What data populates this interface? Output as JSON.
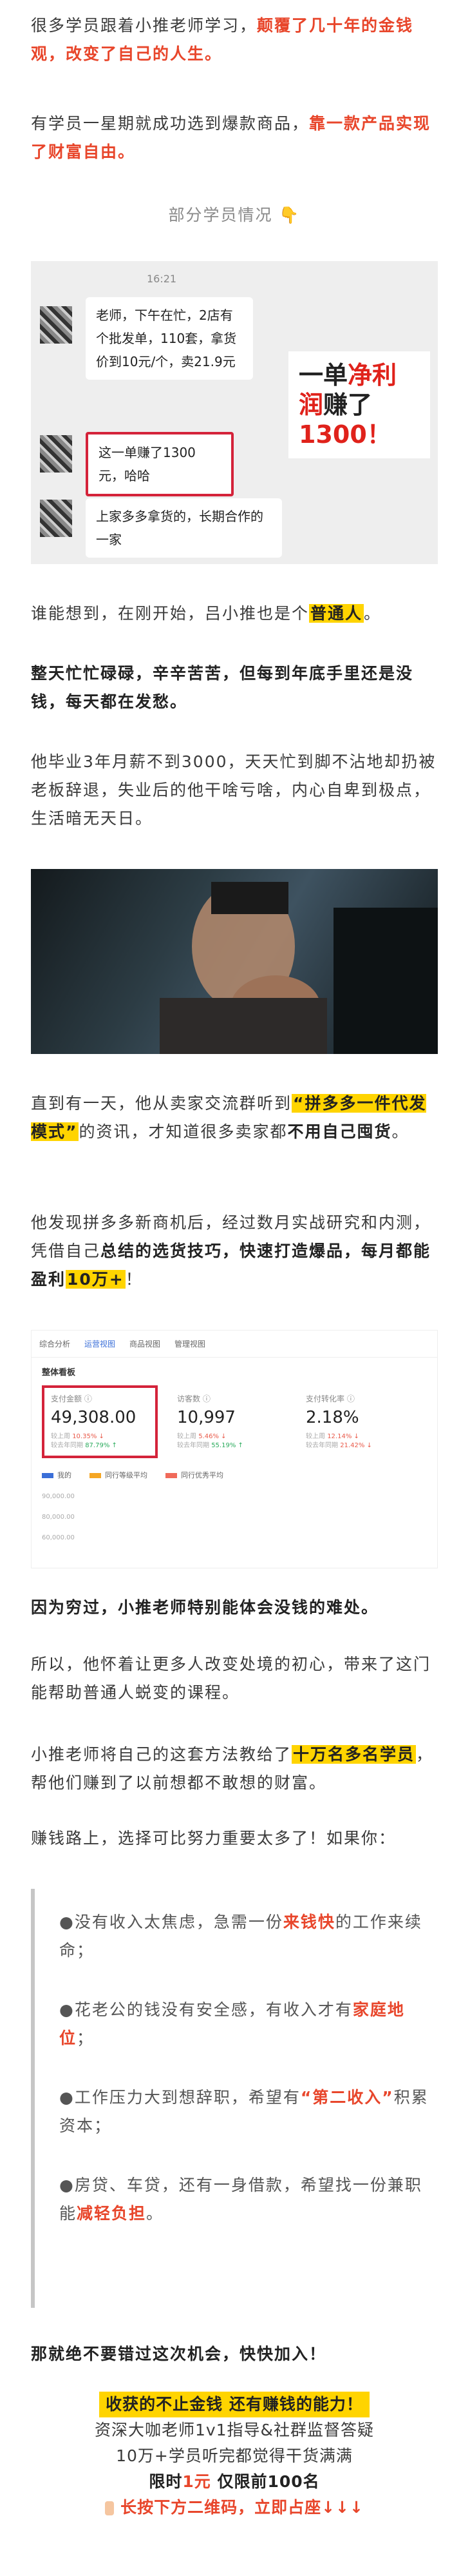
{
  "para1": {
    "a": "很多学员跟着小推老师学习，",
    "b": "颠覆了几十年的金钱观，改变了自己的人生。"
  },
  "para2": {
    "a": "有学员一星期就成功选到爆款商品，",
    "b": "靠一款产品实现了财富自由。"
  },
  "students_caption": "部分学员情况 👇",
  "chat": {
    "time": "16:21",
    "msg1": "老师，下午在忙，2店有个批发单，110套，拿货价到10元/个，卖21.9元",
    "msg2": "这一单赚了1300元，哈哈",
    "msg3": "上家多多拿货的，长期合作的一家",
    "caption_a": "一单",
    "caption_b": "净利润",
    "caption_c": "赚了",
    "caption_d": "1300！"
  },
  "para3": {
    "a": "谁能想到，在刚开始，吕小推也是个",
    "b": "普通人",
    "c": "。"
  },
  "para4": "整天忙忙碌碌，辛辛苦苦，但每到年底手里还是没钱，每天都在发愁。",
  "para5": "他毕业3年月薪不到3000，天天忙到脚不沾地却扔被老板辞退，失业后的他干啥亏啥，内心自卑到极点，生活暗无天日。",
  "para6": {
    "a": "直到有一天，他从卖家交流群听到",
    "b": "“拼多多一件代发模式”",
    "c": "的资讯，才知道很多卖家都",
    "d": "不用自己囤货",
    "e": "。"
  },
  "para7": {
    "a": "他发现拼多多新商机后，经过数月实战研究和内测，凭借自己",
    "b": "总结的选货技巧，快速打造爆品，每月都能盈利",
    "c": "10万+",
    "d": "！"
  },
  "dashboard": {
    "tabs": [
      "综合分析",
      "运营视图",
      "商品视图",
      "管理视图"
    ],
    "section_title": "整体看板",
    "cards": [
      {
        "label": "支付金额 ⓘ",
        "value": "49,308.00",
        "sub1": "较上周",
        "sub2": "较去年同期",
        "sub1v": "10.35% ↓",
        "sub2v": "87.79% ↑"
      },
      {
        "label": "访客数 ⓘ",
        "value": "10,997",
        "sub1": "较上周",
        "sub2": "较去年同期",
        "sub1v": "5.46% ↓",
        "sub2v": "55.19% ↑"
      },
      {
        "label": "支付转化率 ⓘ",
        "value": "2.18%",
        "sub1": "较上周",
        "sub2": "较去年同期",
        "sub1v": "12.14% ↓",
        "sub2v": "21.42% ↓"
      }
    ],
    "legend": [
      "我的",
      "同行等级平均",
      "同行优秀平均"
    ],
    "axis": [
      "90,000.00",
      "80,000.00",
      "60,000.00"
    ]
  },
  "para8": "因为穷过，小推老师特别能体会没钱的难处。",
  "para9": "所以，他怀着让更多人改变处境的初心，带来了这门能帮助普通人蜕变的课程。",
  "para10": {
    "a": "小推老师将自己的这套方法教给了",
    "b": "十万名多名学员",
    "c": "，帮他们赚到了以前想都不敢想的财富。"
  },
  "para11": "赚钱路上，选择可比努力重要太多了！如果你：",
  "quote": {
    "q1a": "●没有收入太焦虑，急需一份",
    "q1b": "来钱快",
    "q1c": "的工作来续命；",
    "q2a": "●花老公的钱没有安全感，有收入才有",
    "q2b": "家庭地位",
    "q2c": "；",
    "q3a": "●工作压力大到想辞职，希望有",
    "q3b": "“第二收入”",
    "q3c": "积累资本；",
    "q4a": "●房贷、车贷，还有一身借款，希望找一份兼职能",
    "q4b": "减轻负担",
    "q4c": "。"
  },
  "final": "那就绝不要错过这次机会，快快加入！",
  "promo": {
    "l1": "收获的不止金钱 还有赚钱的能力！",
    "l2": "资深大咖老师1v1指导&社群监督答疑",
    "l3": "10万+学员听完都觉得干货满满",
    "l4a": "限时",
    "l4b": "1元",
    "l4c": " 仅限前100名",
    "l5": "长按下方二维码，立即占座↓↓↓"
  }
}
